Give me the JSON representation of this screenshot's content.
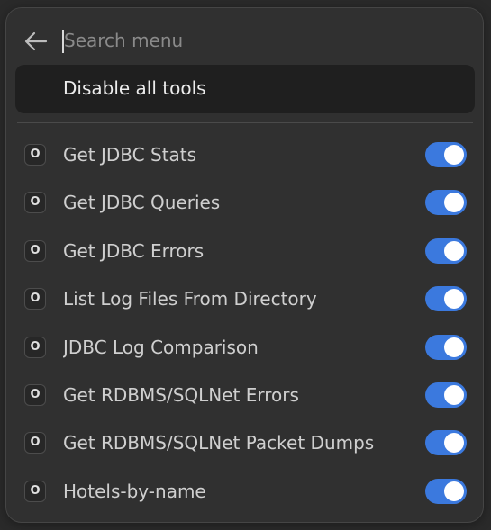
{
  "search": {
    "placeholder": "Search menu",
    "value": ""
  },
  "disable_all_label": "Disable all tools",
  "colors": {
    "panel": "#303030",
    "toggle_on": "#3b79de",
    "text": "#cfcfcf"
  },
  "tools": [
    {
      "icon": "O",
      "label": "Get JDBC Stats",
      "enabled": true
    },
    {
      "icon": "O",
      "label": "Get JDBC Queries",
      "enabled": true
    },
    {
      "icon": "O",
      "label": "Get JDBC Errors",
      "enabled": true
    },
    {
      "icon": "O",
      "label": "List Log Files From Directory",
      "enabled": true
    },
    {
      "icon": "O",
      "label": "JDBC Log Comparison",
      "enabled": true
    },
    {
      "icon": "O",
      "label": "Get RDBMS/SQLNet Errors",
      "enabled": true
    },
    {
      "icon": "O",
      "label": "Get RDBMS/SQLNet Packet Dumps",
      "enabled": true
    },
    {
      "icon": "O",
      "label": "Hotels-by-name",
      "enabled": true
    }
  ]
}
